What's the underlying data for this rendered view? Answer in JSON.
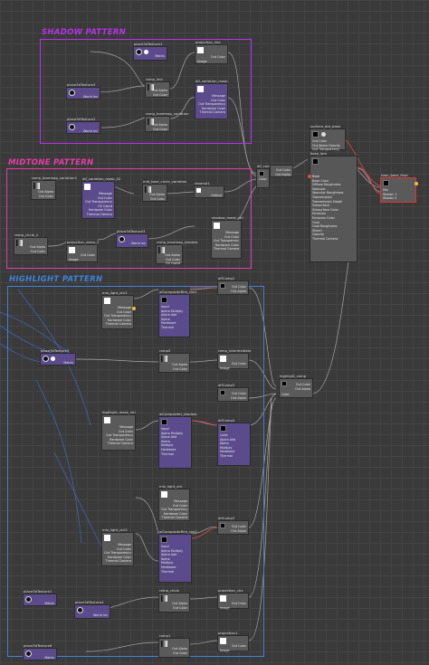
{
  "groups": {
    "shadow": {
      "title": "SHADOW PATTERN",
      "color": "#b832e8"
    },
    "midtone": {
      "title": "MIDTONE PATTERN",
      "color": "#e83ca8"
    },
    "highlight": {
      "title": "HIGHLIGHT PATTERN",
      "color": "#3f82d8"
    }
  },
  "nodes": {
    "place3d_shadow": {
      "label": "place3dTexture1",
      "ports": [
        "Matrix"
      ]
    },
    "projection_line": {
      "label": "projection_line",
      "ports": [
        "Out Color",
        "Out Alpha"
      ],
      "ports_l": [
        "Image"
      ]
    },
    "place3d_sh2": {
      "label": "place3dTexture5",
      "ports": [
        "World Inv"
      ]
    },
    "ramp_line": {
      "label": "ramp_line",
      "ports": [
        "Out Alpha",
        "Out Color",
        "UV Coord"
      ]
    },
    "dif_variation_mask": {
      "label": "dif_variation_mask",
      "ports": [
        "Message",
        "Out Color",
        "Out Transparency",
        "Hardware Color",
        "Thermal Camera"
      ]
    },
    "place3d_sh3": {
      "label": "place3dTexture2",
      "ports": [
        "World Inv"
      ]
    },
    "ramp_tonemap_variation": {
      "label": "ramp_tonemap_variation",
      "ports": [
        "Out Alpha",
        "Out Color",
        "UV Coord"
      ]
    },
    "dif_comp": {
      "label": "dif_comp",
      "ports": [
        "Out Color",
        "Out Alpha"
      ],
      "ports_l": [
        "Color"
      ]
    },
    "surface_dot_base": {
      "label": "surface_dot_base",
      "ports": [
        "Out Color",
        "Out Alpha Opacity",
        "Out Transparency"
      ]
    },
    "base_lam": {
      "label": "base_lam",
      "ports": [
        "Base",
        "Base Color",
        "Diffuse Roughness",
        "Specular",
        "Specular Roughness",
        "Transmission",
        "Transmission Depth",
        "Subsurface",
        "Subsurface Color",
        "Emission",
        "Emission Color",
        "Coat",
        "Coat Roughness",
        "Sheen",
        "Opacity",
        "Thermal Camera"
      ]
    },
    "toon_base": {
      "label": "toon_base_final",
      "ports": [
        "Out Color"
      ],
      "ports_l": [
        "Mix",
        "Shader 1",
        "Shader 2"
      ]
    },
    "ramp_tonemap_variation1": {
      "label": "ramp_tonemap_variation1",
      "ports": [
        "Out Alpha",
        "Out Color",
        "UV Coord"
      ]
    },
    "dif_variation_mask_02": {
      "label": "dif_variation_mask_02",
      "ports": [
        "Message",
        "Out Color",
        "Out Transparency",
        "UV Coord",
        "Hardware Color",
        "Thermal Camera"
      ]
    },
    "mid_tone_circle": {
      "label": "mid_tone_circle_variation",
      "ports": [
        "Out Alpha",
        "Out Color",
        "UV Coord"
      ]
    },
    "reverse1": {
      "label": "reverse1",
      "ports": [
        "Output"
      ],
      "ports_l": [
        "Input"
      ]
    },
    "shadow_mask_ctrl": {
      "label": "shadow_mask_ctrl",
      "ports": [
        "Message",
        "Out Color",
        "Out Transparency",
        "Hardware Color",
        "Thermal Camera"
      ]
    },
    "ramp_circle": {
      "label": "ramp_circle_2",
      "ports": [
        "Out Alpha",
        "Out Color",
        "UV Coord"
      ]
    },
    "projection_ramp": {
      "label": "projection_ramp_2",
      "ports": [
        "Out Color",
        "Out Alpha"
      ],
      "ports_l": [
        "Image"
      ]
    },
    "place3d_mid": {
      "label": "place3dTexture3",
      "ports": [
        "World Inv"
      ]
    },
    "ramp_tonemap_shadow": {
      "label": "ramp_tonemap_shadow",
      "ports": [
        "Out Alpha",
        "Out Color",
        "UV Coord"
      ]
    },
    "mix_light_ctrl1": {
      "label": "mix_light_ctrl1",
      "ports": [
        "Message",
        "Out Color",
        "Out Transparency",
        "Hardware Color",
        "Thermal Camera"
      ]
    },
    "aiCompositor_rim1": {
      "label": "aiCompositeRim_rim1",
      "ports": [
        "Out Color",
        "Out Alpha"
      ],
      "ports_l": [
        "Input",
        "Alpha Multiply",
        "Alpha Add",
        "Alpha",
        "Hardware",
        "Thermal"
      ]
    },
    "dif_comp2": {
      "label": "difComp2",
      "ports": [
        "Out Color",
        "Out Alpha"
      ],
      "ports_l": [
        "Color"
      ]
    },
    "place3d_hl": {
      "label": "place3dTexture5",
      "ports": [
        "Matrix"
      ]
    },
    "ramp_a": {
      "label": "ramp5",
      "ports": [
        "Out Alpha",
        "Out Color",
        "UV Coord"
      ]
    },
    "ramp_intermediate": {
      "label": "ramp_intermediate",
      "ports": [
        "Out Color",
        "Out Alpha"
      ],
      "ports_l": [
        "Image"
      ]
    },
    "dif_comp3": {
      "label": "difComp3",
      "ports": [
        "Out Color",
        "Out Alpha"
      ],
      "ports_l": [
        "Color"
      ]
    },
    "highlight_comp": {
      "label": "highlight_comp",
      "ports": [
        "Out Color",
        "Out Alpha"
      ],
      "ports_l": [
        "Color"
      ]
    },
    "highlight_mask_ctrl": {
      "label": "highlight_mask_ctrl",
      "ports": [
        "Message",
        "Out Color",
        "Out Transparency",
        "Hardware Color",
        "Thermal Camera"
      ]
    },
    "aiCompositor_shadow": {
      "label": "aiCompositeI_shadow",
      "ports": [
        "Out Color",
        "Out Alpha"
      ],
      "ports_l": [
        "Input",
        "Alpha Multiply",
        "Alpha Add",
        "Alpha",
        "Multiply",
        "Hardware",
        "Thermal"
      ]
    },
    "dif_comp4": {
      "label": "difComp4",
      "ports": [
        "Out Color",
        "Out Alpha"
      ],
      "ports_l": [
        "Color",
        "Alpha Add",
        "Alpha",
        "Multiply",
        "Hardware",
        "Thermal"
      ]
    },
    "mix_light_ctrl": {
      "label": "mix_light_ctrl",
      "ports": [
        "Message",
        "Out Color",
        "Out Transparency",
        "Hardware Color",
        "Thermal Camera"
      ]
    },
    "mix_light_ctrl2": {
      "label": "mix_light_ctrl2",
      "ports": [
        "Message",
        "Out Color",
        "Out Transparency",
        "Hardware Color",
        "Thermal Camera"
      ]
    },
    "aiCompositor_rim2": {
      "label": "aiCompositeRim_rim2",
      "ports": [
        "Out Color",
        "Out Alpha"
      ],
      "ports_l": [
        "Input",
        "Alpha Multiply",
        "Alpha Add",
        "Alpha",
        "Multiply",
        "Hardware",
        "Thermal"
      ]
    },
    "dif_comp5": {
      "label": "difComp3",
      "ports": [
        "Out Color",
        "Out Alpha"
      ],
      "ports_l": [
        "Color"
      ]
    },
    "place3d_hl2": {
      "label": "place3dTexture1",
      "ports": [
        "Matrix"
      ]
    },
    "place3d_hl3": {
      "label": "place3dTexture4",
      "ports": [
        "World Inv"
      ]
    },
    "ramp_circle2": {
      "label": "ramp_circle",
      "ports": [
        "Out Alpha",
        "Out Color",
        "UV Coord"
      ]
    },
    "projection_circ": {
      "label": "projection_circ",
      "ports": [
        "Out Color",
        "Out Alpha"
      ],
      "ports_l": [
        "Image"
      ]
    },
    "place3d_hl4": {
      "label": "place3dTexture6",
      "ports": [
        "Matrix"
      ]
    },
    "ramp1": {
      "label": "ramp1",
      "ports": [
        "Out Alpha",
        "Out Color",
        "UV Coord"
      ]
    },
    "projection1": {
      "label": "projection1",
      "ports": [
        "Out Color",
        "Out Alpha"
      ],
      "ports_l": [
        "Image"
      ]
    }
  }
}
